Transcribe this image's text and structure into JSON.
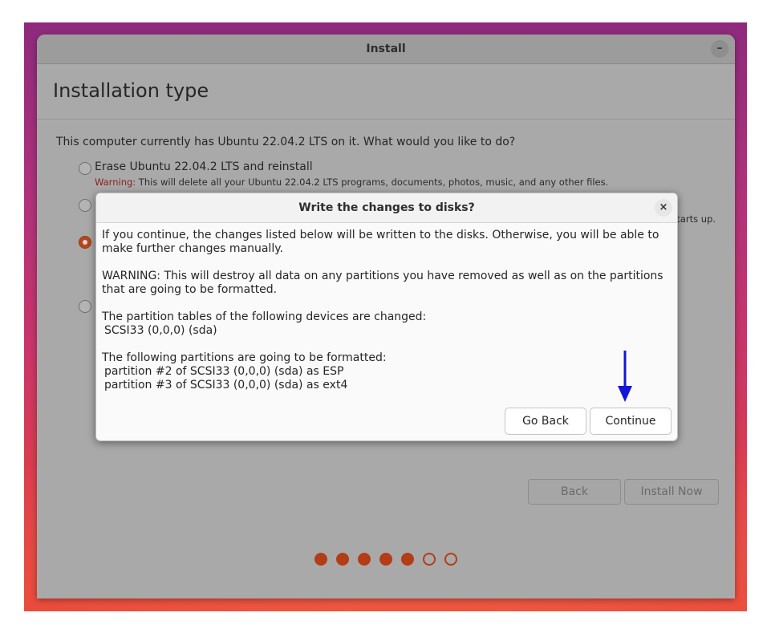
{
  "window": {
    "title": "Install",
    "minimize_glyph": "–"
  },
  "page": {
    "title": "Installation type",
    "question": "This computer currently has Ubuntu 22.04.2 LTS on it. What would you like to do?",
    "options": [
      {
        "label": "Erase Ubuntu 22.04.2 LTS and reinstall",
        "selected": false
      },
      {
        "label": "",
        "selected": false
      },
      {
        "label": "",
        "selected": true
      },
      {
        "label": "",
        "selected": false
      }
    ],
    "warning_prefix": "Warning:",
    "warning_text": " This will delete all your Ubuntu 22.04.2 LTS programs, documents, photos, music, and any other files.",
    "partial_text": "starts up."
  },
  "nav": {
    "back_label": "Back",
    "install_now_label": "Install Now"
  },
  "progress": {
    "current_step": 5,
    "total_steps": 7
  },
  "dialog": {
    "title": "Write the changes to disks?",
    "close_glyph": "×",
    "para1": "If you continue, the changes listed below will be written to the disks. Otherwise, you will be able to make further changes manually.",
    "para2": "WARNING: This will destroy all data on any partitions you have removed as well as on the partitions that are going to be formatted.",
    "tables_heading": "The partition tables of the following devices are changed:",
    "tables_device": "SCSI33 (0,0,0) (sda)",
    "format_heading": "The following partitions are going to be formatted:",
    "format_items": [
      "partition #2 of SCSI33 (0,0,0) (sda) as ESP",
      "partition #3 of SCSI33 (0,0,0) (sda) as ext4"
    ],
    "go_back_label": "Go Back",
    "continue_label": "Continue"
  },
  "colors": {
    "accent": "#b23d17",
    "arrow": "#1515d8"
  },
  "icons": {
    "annotation": "down-arrow-icon"
  }
}
